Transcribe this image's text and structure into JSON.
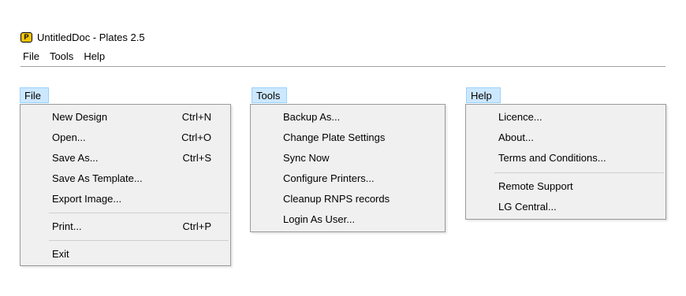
{
  "window": {
    "app_icon_letter": "P",
    "title": "UntitledDoc - Plates 2.5"
  },
  "menubar": {
    "items": [
      "File",
      "Tools",
      "Help"
    ]
  },
  "file_menu": {
    "header": "File",
    "items": [
      {
        "label": "New Design",
        "shortcut": "Ctrl+N"
      },
      {
        "label": "Open...",
        "shortcut": "Ctrl+O"
      },
      {
        "label": "Save As...",
        "shortcut": "Ctrl+S"
      },
      {
        "label": "Save As Template...",
        "shortcut": ""
      },
      {
        "label": "Export Image...",
        "shortcut": ""
      },
      {
        "label": "Print...",
        "shortcut": "Ctrl+P"
      },
      {
        "label": "Exit",
        "shortcut": ""
      }
    ]
  },
  "tools_menu": {
    "header": "Tools",
    "items": [
      {
        "label": "Backup As..."
      },
      {
        "label": "Change Plate Settings"
      },
      {
        "label": "Sync Now"
      },
      {
        "label": "Configure Printers..."
      },
      {
        "label": "Cleanup RNPS records"
      },
      {
        "label": "Login As User..."
      }
    ]
  },
  "help_menu": {
    "header": "Help",
    "items": [
      {
        "label": "Licence..."
      },
      {
        "label": "About..."
      },
      {
        "label": "Terms and Conditions..."
      },
      {
        "label": "Remote Support"
      },
      {
        "label": "LG Central..."
      }
    ]
  },
  "colors": {
    "header_highlight": "#cce8ff",
    "header_border": "#99d1ff",
    "menu_background": "#f0f0f0",
    "app_icon": "#f5c400"
  }
}
